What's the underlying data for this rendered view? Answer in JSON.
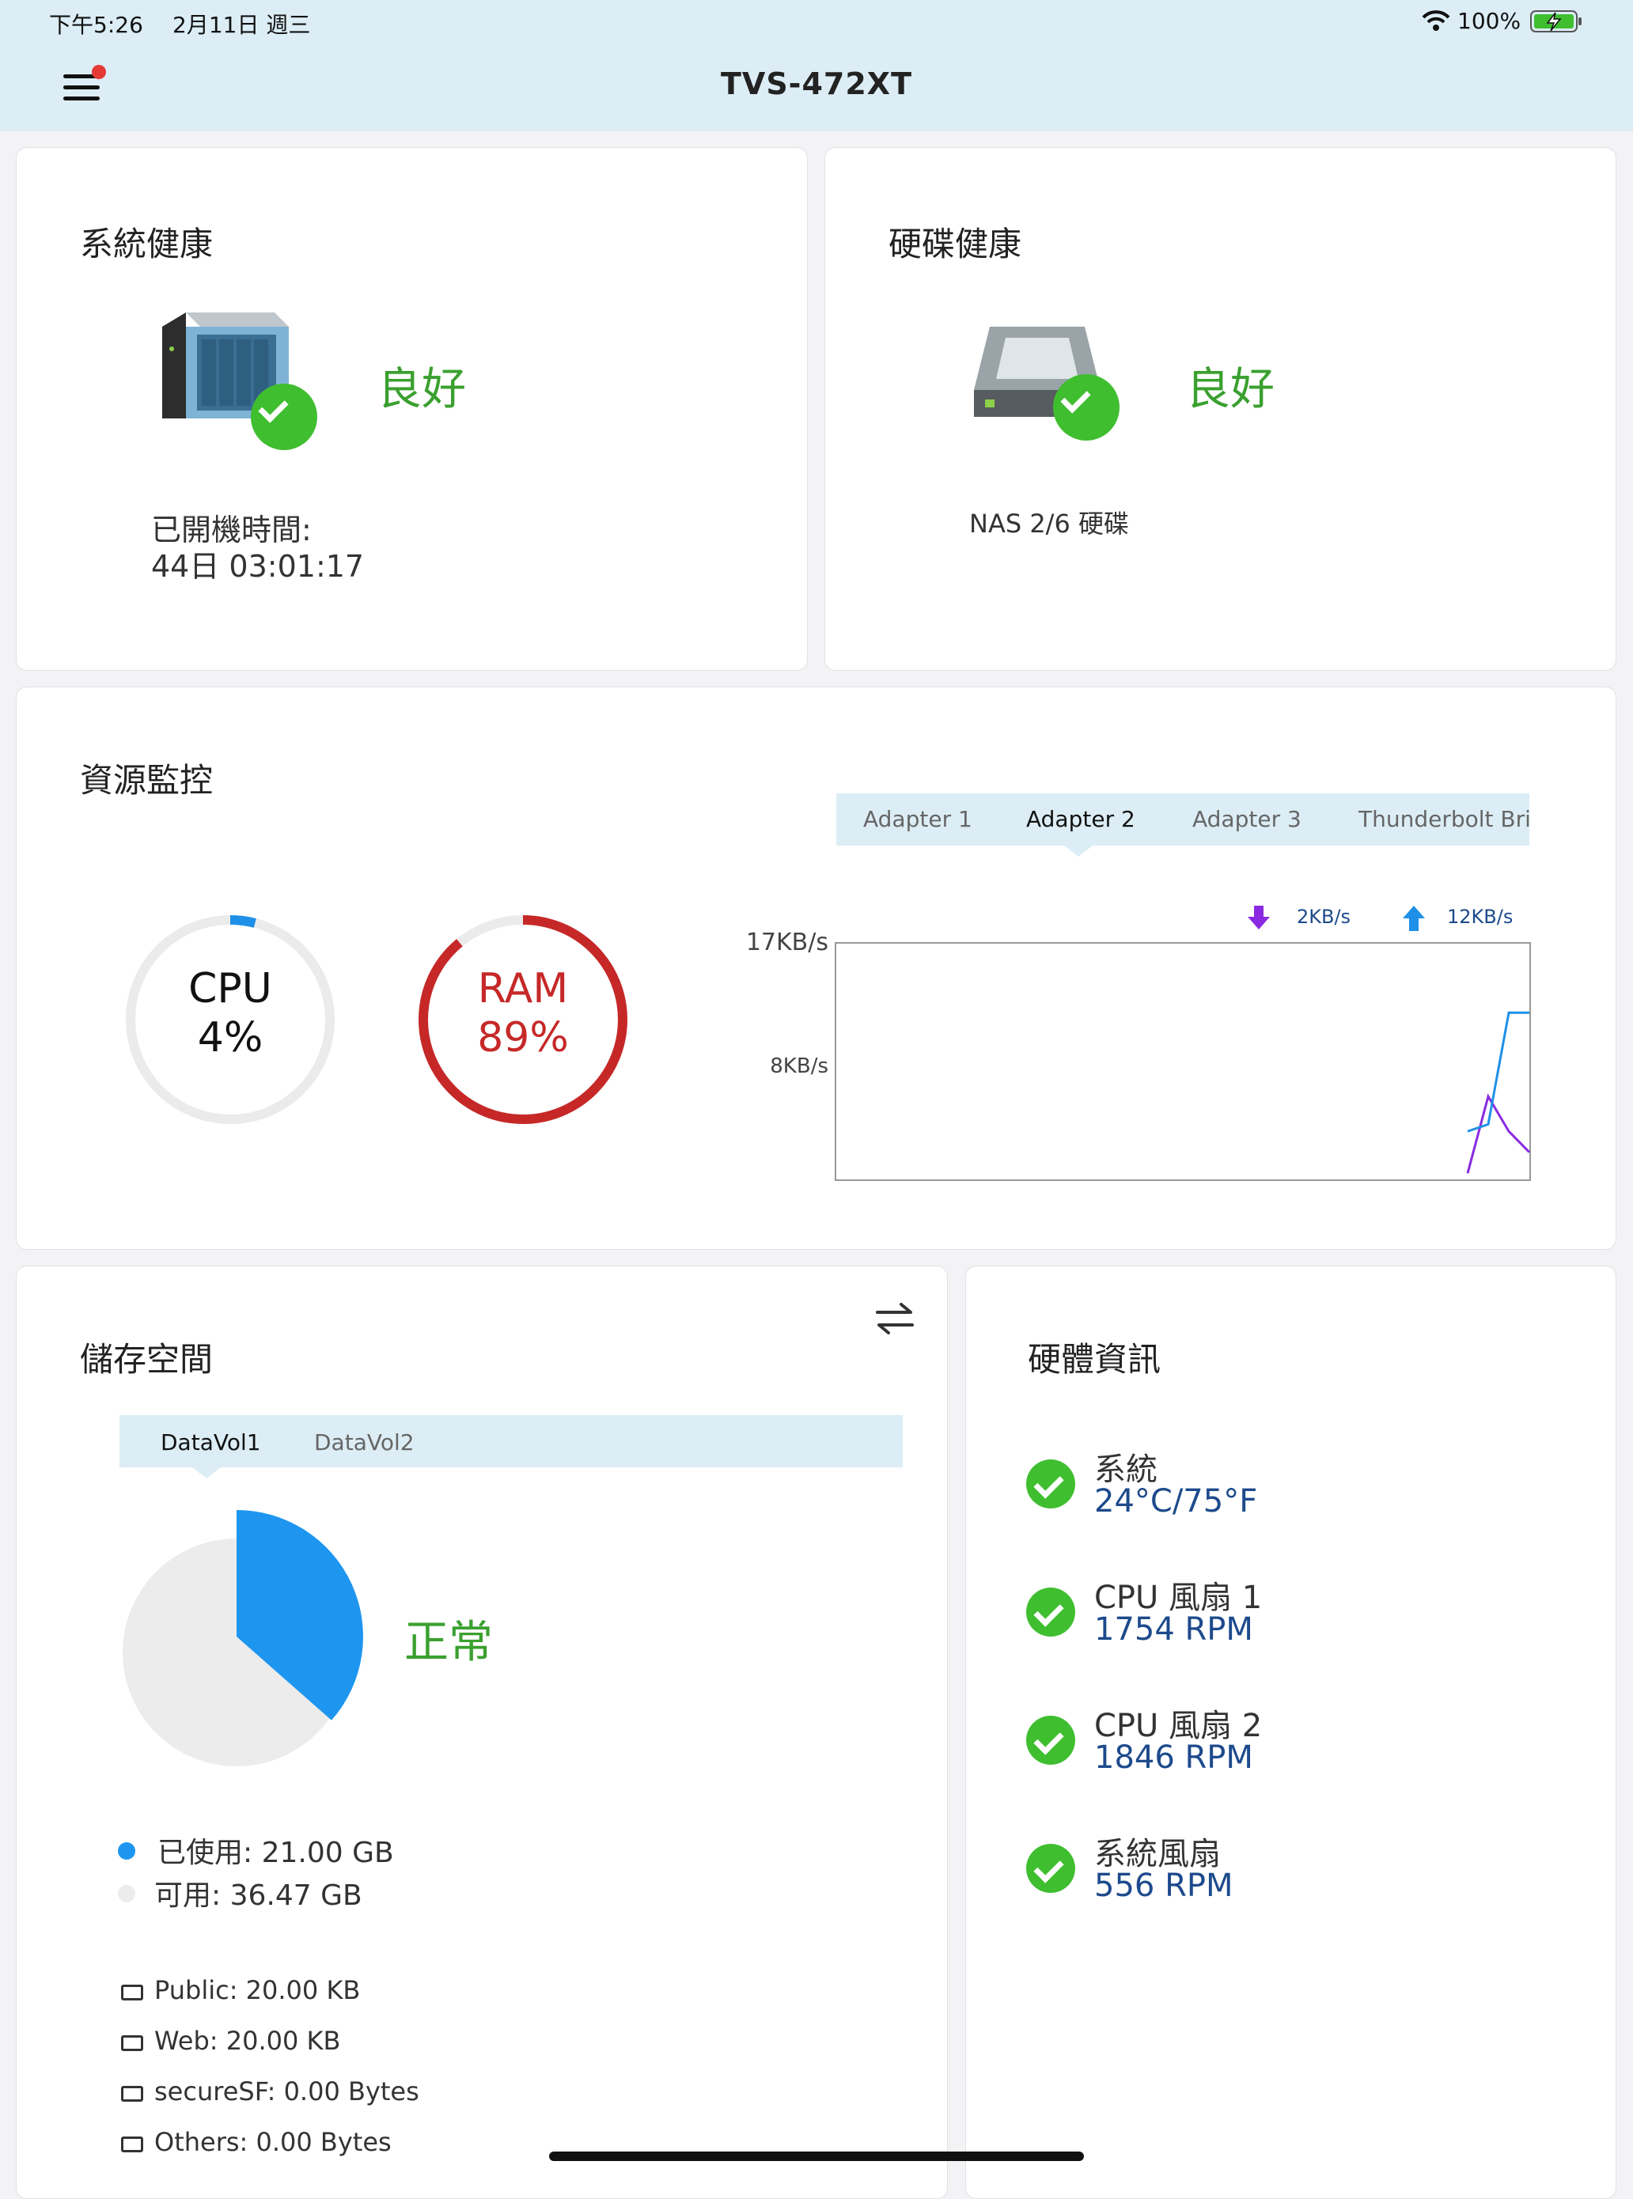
{
  "status_bar": {
    "time": "下午5:26",
    "date": "2月11日 週三",
    "battery": "100%"
  },
  "header": {
    "title": "TVS-472XT"
  },
  "system_health": {
    "title": "系統健康",
    "status": "良好",
    "uptime_label": "已開機時間:",
    "uptime_value": "44日 03:01:17"
  },
  "disk_health": {
    "title": "硬碟健康",
    "status": "良好",
    "disk_summary": "NAS 2/6 硬碟"
  },
  "resource_monitor": {
    "title": "資源監控",
    "cpu": {
      "label": "CPU",
      "value": "4%",
      "percent": 4,
      "color": "#1e90e8"
    },
    "ram": {
      "label": "RAM",
      "value": "89%",
      "percent": 89,
      "color": "#c62828"
    },
    "tabs": [
      "Adapter 1",
      "Adapter 2",
      "Adapter 3",
      "Thunderbolt Bri"
    ],
    "active_tab": 1,
    "legend": {
      "download": "2KB/s",
      "upload": "12KB/s",
      "download_color": "#8a2be2",
      "upload_color": "#1e90e8"
    }
  },
  "chart_data": {
    "type": "line",
    "y_ticks": [
      "17KB/s",
      "8KB/s"
    ],
    "ylim": [
      0,
      17
    ],
    "x": [
      0,
      1,
      2,
      3
    ],
    "series": [
      {
        "name": "2KB/s",
        "values": [
          0.5,
          6,
          3.5,
          2
        ]
      },
      {
        "name": "12KB/s",
        "values": [
          3.5,
          4,
          12,
          12
        ]
      }
    ]
  },
  "storage": {
    "title": "儲存空間",
    "tabs": [
      "DataVol1",
      "DataVol2"
    ],
    "active_tab": 0,
    "status": "正常",
    "used_label": "已使用: 21.00 GB",
    "free_label": "可用: 36.47 GB",
    "used_fraction": 0.365,
    "used_color": "#1e96f0",
    "free_color": "#ececec",
    "folders": [
      "Public: 20.00 KB",
      "Web: 20.00 KB",
      "secureSF: 0.00 Bytes",
      "Others: 0.00 Bytes"
    ]
  },
  "hardware": {
    "title": "硬體資訊",
    "items": [
      {
        "label": "系統",
        "value": "24°C/75°F"
      },
      {
        "label": "CPU 風扇 1",
        "value": "1754 RPM"
      },
      {
        "label": "CPU 風扇 2",
        "value": "1846 RPM"
      },
      {
        "label": "系統風扇",
        "value": "556 RPM"
      }
    ]
  }
}
